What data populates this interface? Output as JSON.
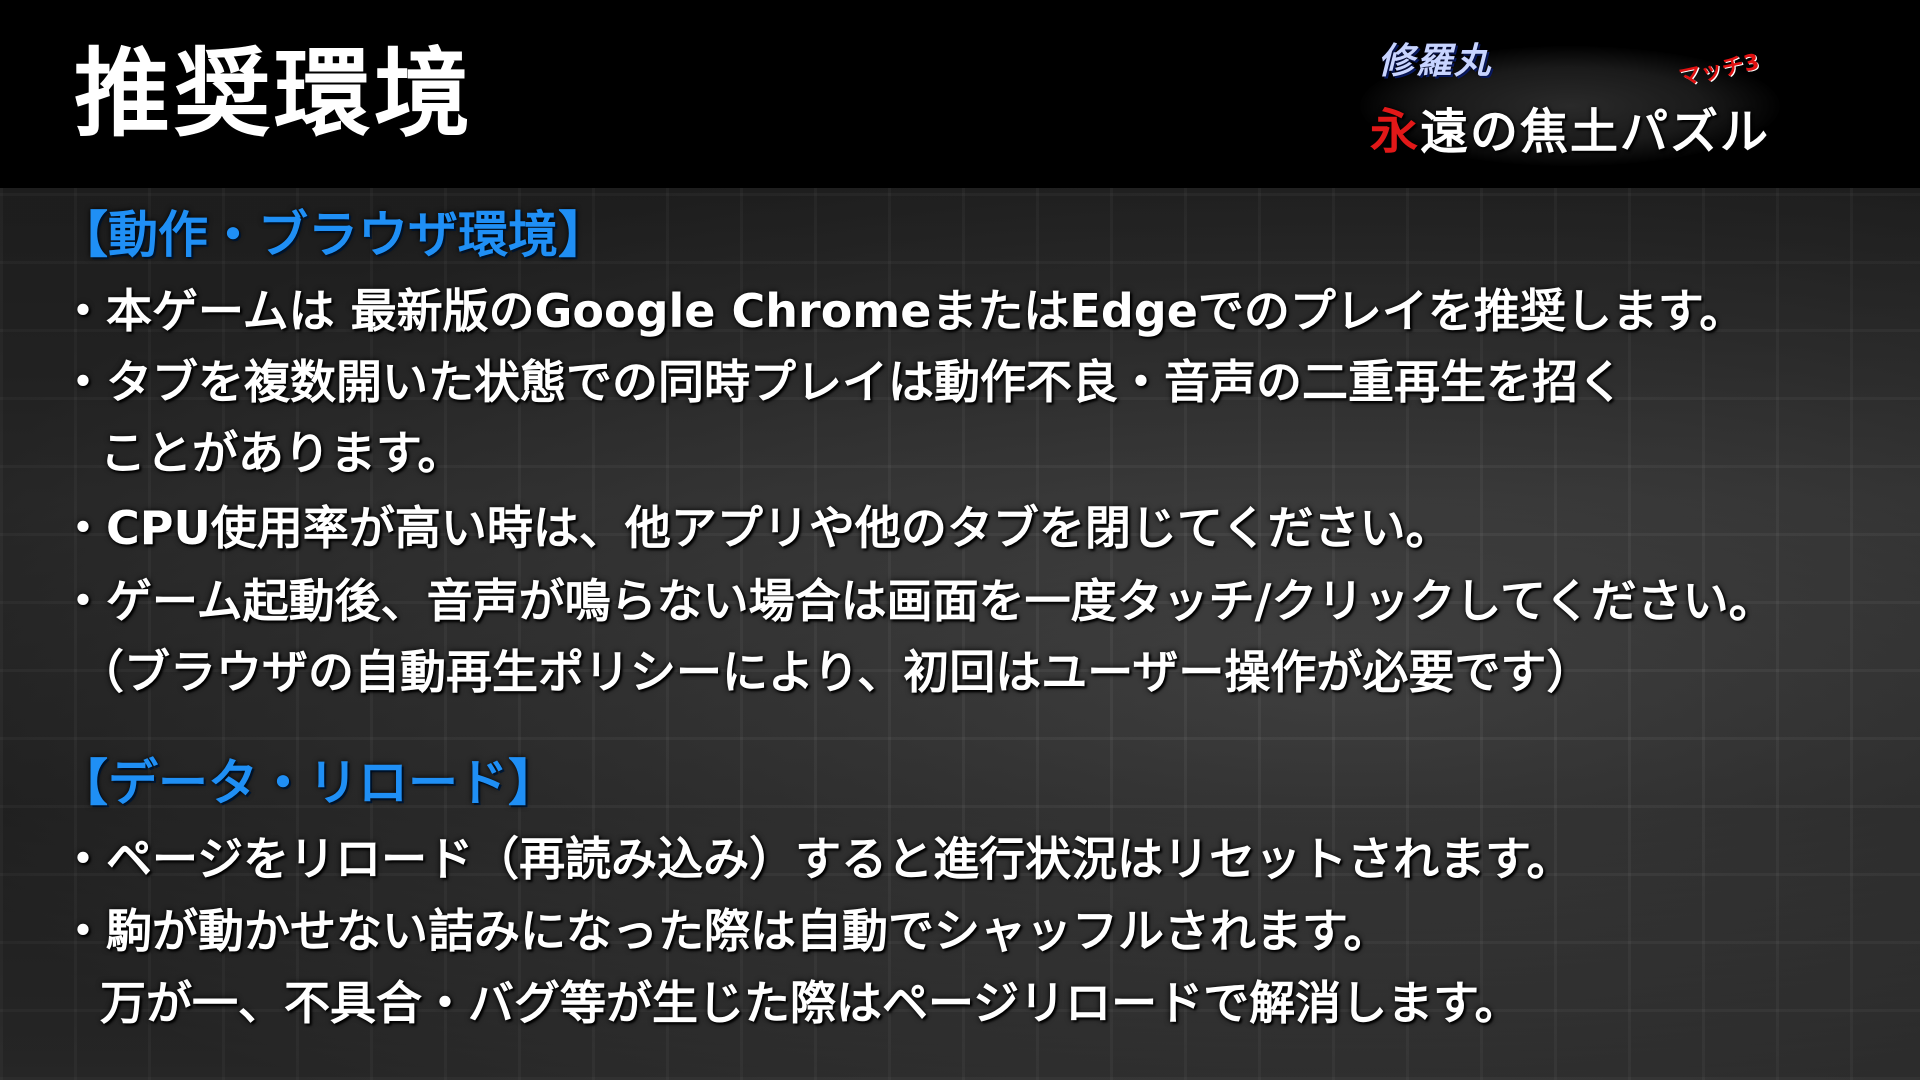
{
  "header": {
    "title": "推奨環境"
  },
  "logo": {
    "top_text": "修羅丸",
    "match_text": "マッチ3",
    "main_red": "永",
    "main_rest": "遠の焦土パズル"
  },
  "sections": [
    {
      "title": "【動作・ブラウザ環境】",
      "lines": [
        "・本ゲームは 最新版のGoogle ChromeまたはEdgeでのプレイを推奨します。",
        "・タブを複数開いた状態での同時プレイは動作不良・音声の二重再生を招く",
        "ことがあります。",
        "・CPU使用率が高い時は、他アプリや他のタブを閉じてください。",
        "・ゲーム起動後、音声が鳴らない場合は画面を一度タッチ/クリックしてください。",
        "（ブラウザの自動再生ポリシーにより、初回はユーザー操作が必要です）"
      ]
    },
    {
      "title": "【データ・リロード】",
      "lines": [
        "・ページをリロード（再読み込み）すると進行状況はリセットされます。",
        "・駒が動かせない詰みになった際は自動でシャッフルされます。",
        "万が一、不具合・バグ等が生じた際はページリロードで解消します。"
      ]
    }
  ],
  "colors": {
    "section_title": "#1f8ff5",
    "body_text": "#ffffff",
    "header_bg": "#000000",
    "logo_red": "#e21818"
  }
}
